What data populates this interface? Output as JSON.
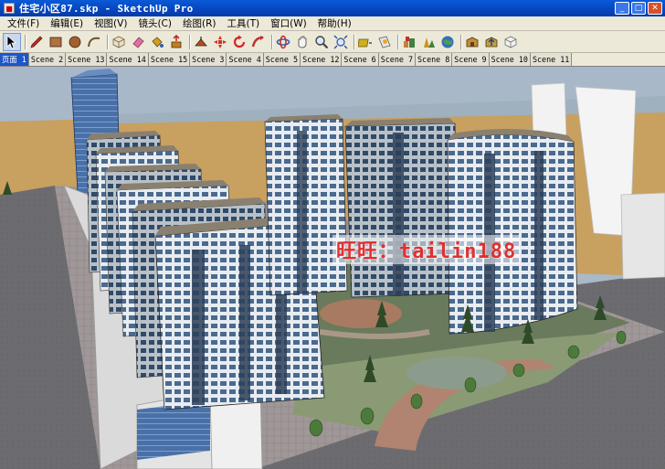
{
  "window": {
    "title": "住宅小区87.skp - SketchUp Pro",
    "controls": [
      "minimize",
      "maximize",
      "close"
    ]
  },
  "menu": [
    {
      "label": "文件(F)"
    },
    {
      "label": "编辑(E)"
    },
    {
      "label": "视图(V)"
    },
    {
      "label": "镜头(C)"
    },
    {
      "label": "绘图(R)"
    },
    {
      "label": "工具(T)"
    },
    {
      "label": "窗口(W)"
    },
    {
      "label": "帮助(H)"
    }
  ],
  "toolbar": {
    "tools": [
      {
        "name": "select-icon",
        "color": "#000000"
      },
      {
        "name": "pencil-icon",
        "color": "#c03020"
      },
      {
        "name": "rectangle-icon",
        "color": "#b07040"
      },
      {
        "name": "circle-icon",
        "color": "#a06030"
      },
      {
        "name": "arc-icon",
        "color": "#705030"
      },
      {
        "name": "make-component-icon",
        "color": "#8a6a3a"
      },
      {
        "name": "eraser-icon",
        "color": "#e070a0"
      },
      {
        "name": "paint-bucket-icon",
        "color": "#d0a020"
      },
      {
        "name": "push-pull-icon",
        "color": "#c08020"
      },
      {
        "name": "offset-icon",
        "color": "#b05020"
      },
      {
        "name": "move-icon",
        "color": "#d03020"
      },
      {
        "name": "rotate-icon",
        "color": "#d02828"
      },
      {
        "name": "follow-me-icon",
        "color": "#c03030"
      },
      {
        "name": "orbit-icon",
        "color": "#3060c0"
      },
      {
        "name": "pan-icon",
        "color": "#e0e0e0"
      },
      {
        "name": "zoom-icon",
        "color": "#404040"
      },
      {
        "name": "zoom-extents-icon",
        "color": "#3050a0"
      },
      {
        "name": "tape-measure-icon",
        "color": "#d0b020"
      },
      {
        "name": "section-plane-icon",
        "color": "#d0d0d0"
      },
      {
        "name": "geo-location-icon",
        "color": "#408040"
      },
      {
        "name": "add-location-icon",
        "color": "#d09020"
      },
      {
        "name": "google-earth-icon",
        "color": "#3070c0"
      },
      {
        "name": "warehouse-get-models-icon",
        "color": "#c09030"
      },
      {
        "name": "warehouse-share-icon",
        "color": "#c0a040"
      },
      {
        "name": "share-component-icon",
        "color": "#e0e0e0"
      }
    ]
  },
  "scenes": {
    "tabs": [
      "页面 1",
      "Scene 2",
      "Scene 13",
      "Scene 14",
      "Scene 15",
      "Scene 3",
      "Scene 4",
      "Scene 5",
      "Scene 12",
      "Scene 6",
      "Scene 7",
      "Scene 8",
      "Scene 9",
      "Scene 10",
      "Scene 11"
    ],
    "active_index": 0
  },
  "viewport": {
    "watermark": "旺旺：tailin188",
    "sky_color": "#a8b8c8",
    "ground_color": "#c8a060"
  }
}
